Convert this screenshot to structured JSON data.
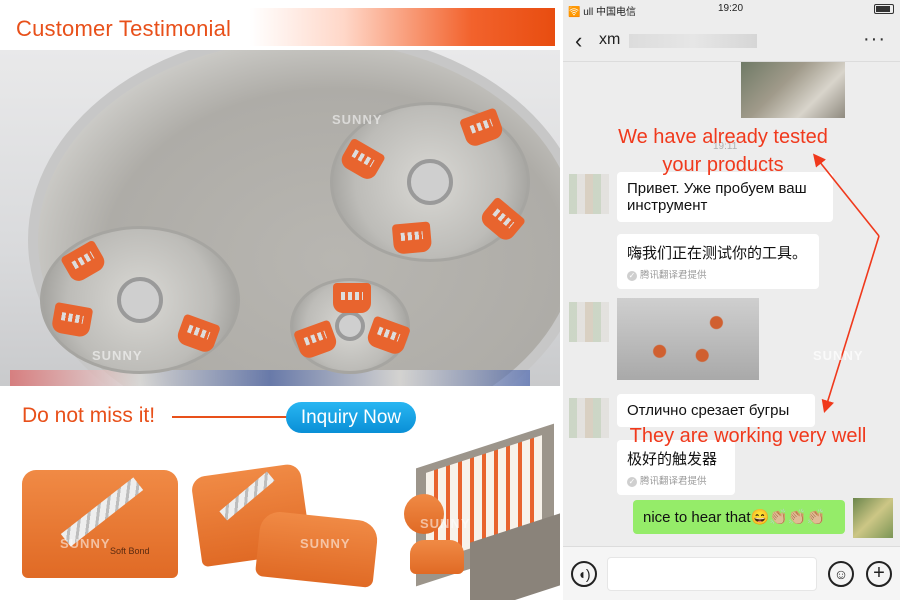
{
  "left": {
    "title": "Customer Testimonial",
    "cta_text": "Do not miss it!",
    "inquiry_button": "Inquiry Now",
    "watermark": "SUNNY",
    "product_label": "Soft Bond"
  },
  "phone": {
    "status": {
      "carrier": "🛜 ull 中国电信",
      "time": "19:20"
    },
    "contact_name": "xm",
    "timestamp": "19:11",
    "messages": [
      {
        "side": "left",
        "text": "Привет. Уже пробуем ваш инструмент"
      },
      {
        "side": "left",
        "text": "嗨我们正在测试你的工具。",
        "translated_by": "腾讯翻译君提供"
      },
      {
        "side": "left",
        "type": "image"
      },
      {
        "side": "left",
        "text": "Отлично срезает бугры"
      },
      {
        "side": "left",
        "text": "极好的触发器",
        "translated_by": "腾讯翻译君提供"
      },
      {
        "side": "right",
        "text": "nice to hear that😄👏🏼👏🏼👏🏼"
      }
    ],
    "annotations": [
      "We have already tested your products",
      "They are working very well"
    ],
    "annotation_lines": [
      "We have already tested",
      "your products"
    ],
    "annotation_color": "#f0391c"
  },
  "colors": {
    "brand_orange": "#e8501a",
    "inquiry_blue": "#1aa3e6",
    "bubble_green": "#95ec69"
  },
  "icons": {
    "back": "chevron-left-icon",
    "more": "more-dots-icon",
    "voice": "voice-icon",
    "emoji": "emoji-icon",
    "plus": "plus-icon"
  }
}
